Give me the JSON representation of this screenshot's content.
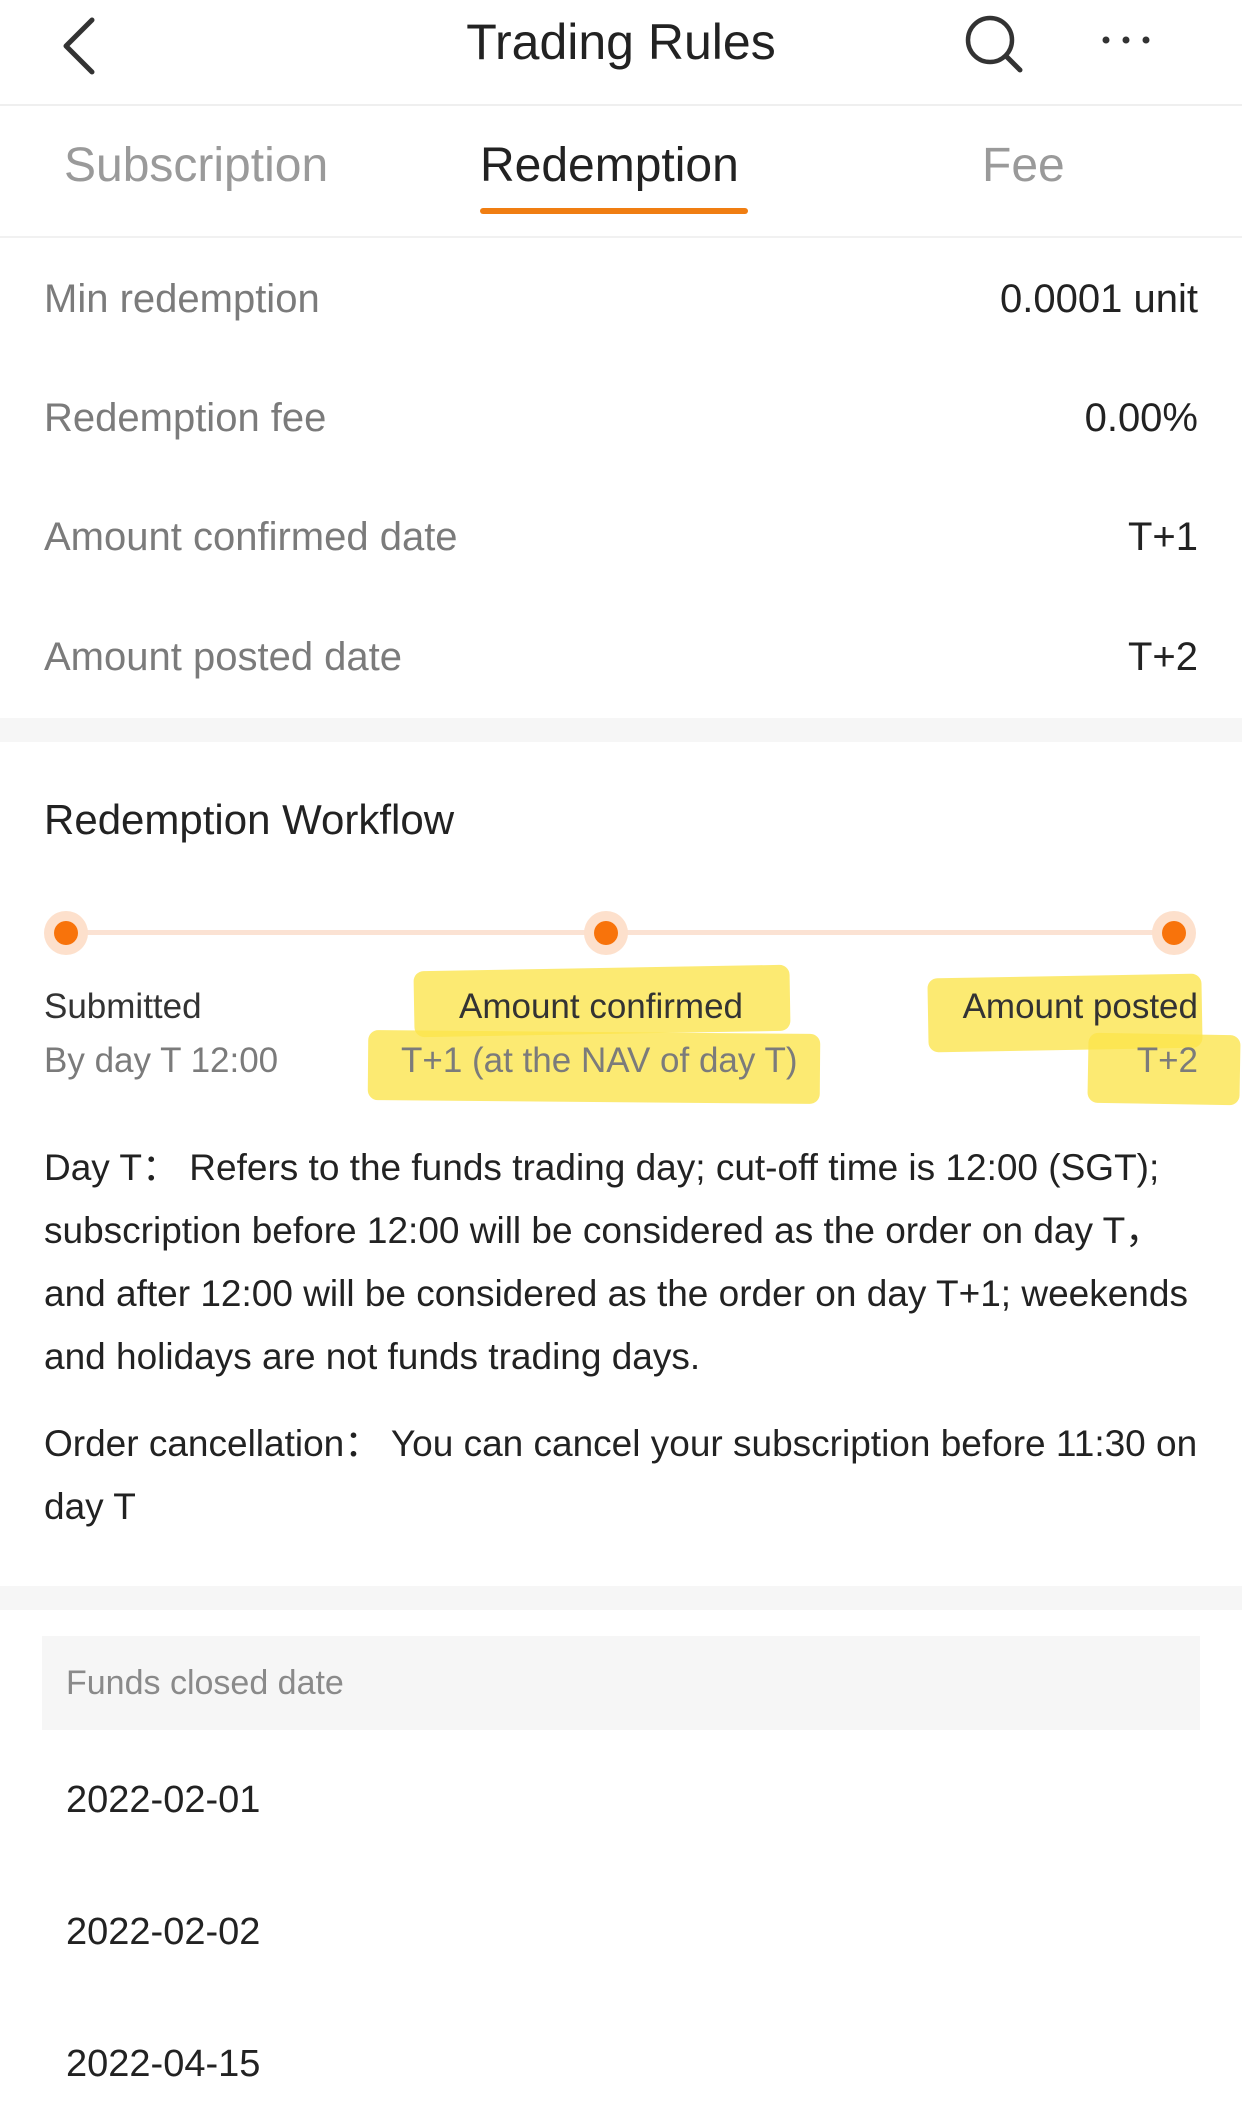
{
  "header": {
    "title": "Trading Rules",
    "back_icon": "chevron-left-icon",
    "search_icon": "search-icon",
    "more_icon": "more-horizontal-icon"
  },
  "tabs": [
    {
      "label": "Subscription",
      "active": false
    },
    {
      "label": "Redemption",
      "active": true
    },
    {
      "label": "Fee",
      "active": false
    }
  ],
  "accent_color": "#f07e12",
  "info": [
    {
      "label": "Min redemption",
      "value": "0.0001 unit"
    },
    {
      "label": "Redemption fee",
      "value": "0.00%"
    },
    {
      "label": "Amount confirmed date",
      "value": "T+1"
    },
    {
      "label": "Amount posted date",
      "value": "T+2"
    }
  ],
  "workflow": {
    "title": "Redemption Workflow",
    "steps": [
      {
        "title": "Submitted",
        "subtitle": "By day T 12:00"
      },
      {
        "title": "Amount confirmed",
        "subtitle": "T+1 (at the NAV of day T)"
      },
      {
        "title": "Amount posted",
        "subtitle": "T+2"
      }
    ]
  },
  "notes": {
    "day_t": "Day T：  Refers to the funds trading day; cut-off time is 12:00 (SGT); subscription before 12:00 will be considered as the order on day T，  and after 12:00 will be considered as the order on day T+1; weekends and holidays are not funds trading days.",
    "cancellation": "Order cancellation：  You can cancel your subscription before 11:30 on day T"
  },
  "closed": {
    "header": "Funds closed date",
    "dates": [
      "2022-02-01",
      "2022-02-02",
      "2022-04-15"
    ]
  }
}
